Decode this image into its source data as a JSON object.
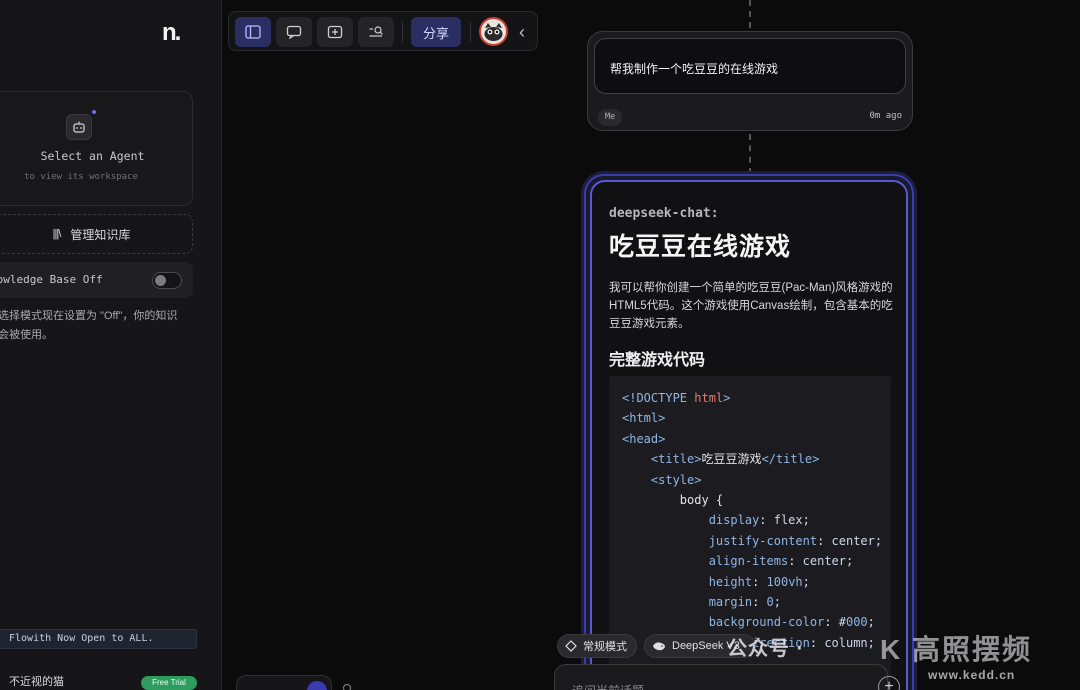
{
  "sidebar": {
    "logo": "n.",
    "agent_card": {
      "title": "Select an Agent",
      "subtitle": "to view its workspace"
    },
    "kb_manage_label": "管理知识库",
    "kb_manage_icon": "library-icon",
    "kb_toggle_label": "nowledge Base Off",
    "kb_toggle_on": false,
    "kb_note": "选择模式现在设置为 \"Off\"，你的知识\n会被使用。",
    "announcement": "Flowith Now Open to ALL.",
    "user_name": "不近视的猫",
    "trial_badge": "Free Trial"
  },
  "toolbar": {
    "share_label": "分享",
    "icons": [
      "sidebar-icon",
      "chat-bubble-icon",
      "add-node-icon",
      "search-list-icon",
      "chevron-left-icon"
    ]
  },
  "canvas": {
    "user_message": {
      "text": "帮我制作一个吃豆豆的在线游戏",
      "author": "Me",
      "time": "0m ago"
    },
    "ai_response": {
      "model": "deepseek-chat:",
      "title": "吃豆豆在线游戏",
      "paragraph": "我可以帮你创建一个简单的吃豆豆(Pac-Man)风格游戏的HTML5代码。这个游戏使用Canvas绘制，包含基本的吃豆豆游戏元素。",
      "section_heading": "完整游戏代码",
      "code_lines": [
        "<!DOCTYPE html>",
        "<html>",
        "<head>",
        "    <title>吃豆豆游戏</title>",
        "    <style>",
        "        body {",
        "            display: flex;",
        "            justify-content: center;",
        "            align-items: center;",
        "            height: 100vh;",
        "            margin: 0;",
        "            background-color: #000;",
        "            flex-direction: column;"
      ]
    }
  },
  "bottom": {
    "mode_label": "常规模式",
    "model_label": "DeepSeek V3",
    "input_placeholder": "追问当前话题",
    "plus": "+"
  },
  "watermark": {
    "text": "公众号 ·",
    "logo": "K 高照摆频",
    "url": "www.kedd.cn"
  },
  "colors": {
    "accent": "#3b3bb0",
    "accent_light": "#5858d8",
    "trial_green": "#2e9c5e",
    "background": "#0b0b0c"
  }
}
